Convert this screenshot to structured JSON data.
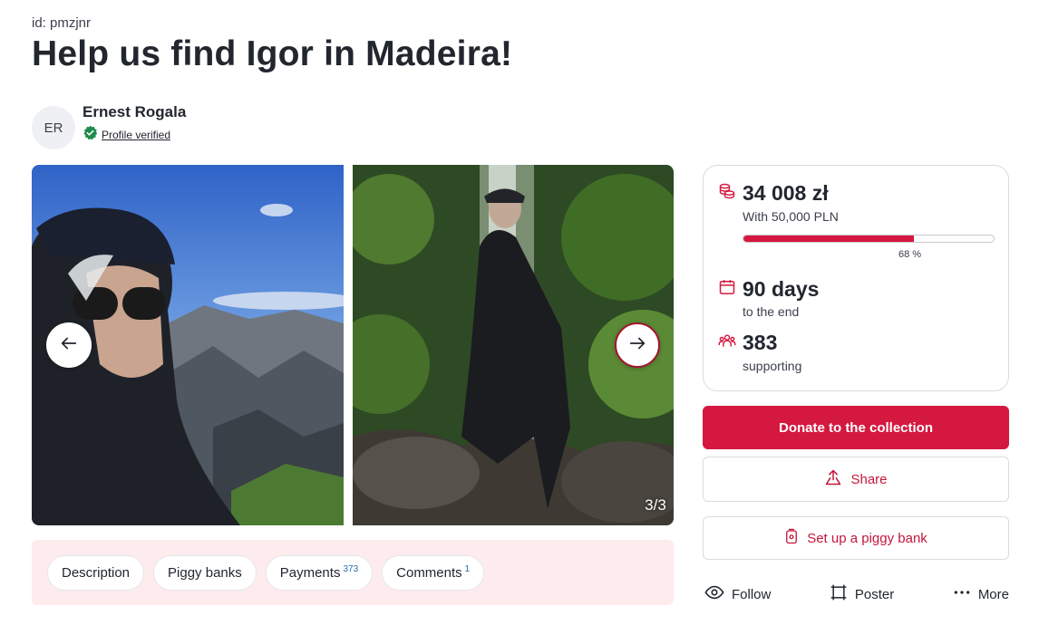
{
  "page": {
    "id_label": "id: pmzjnr",
    "title": "Help us find Igor in Madeira!"
  },
  "author": {
    "initials": "ER",
    "name": "Ernest Rogala",
    "verified_label": "Profile verified"
  },
  "gallery": {
    "counter": "3/3"
  },
  "tabs": [
    {
      "label": "Description",
      "badge": ""
    },
    {
      "label": "Piggy banks",
      "badge": ""
    },
    {
      "label": "Payments",
      "badge": "373"
    },
    {
      "label": "Comments",
      "badge": "1"
    }
  ],
  "stats": {
    "amount": "34 008 zł",
    "goal": "With 50,000 PLN",
    "progress_percent": 68,
    "progress_label": "68 %",
    "days": "90 days",
    "days_sub": "to the end",
    "supporters": "383",
    "supporters_sub": "supporting"
  },
  "buttons": {
    "donate": "Donate to the collection",
    "share": "Share",
    "piggy_bank": "Set up a piggy bank"
  },
  "actions": {
    "follow": "Follow",
    "poster": "Poster",
    "more": "More"
  },
  "colors": {
    "accent": "#d4183f",
    "tabs_background": "#fdebee",
    "verified": "#1f8a4c"
  }
}
